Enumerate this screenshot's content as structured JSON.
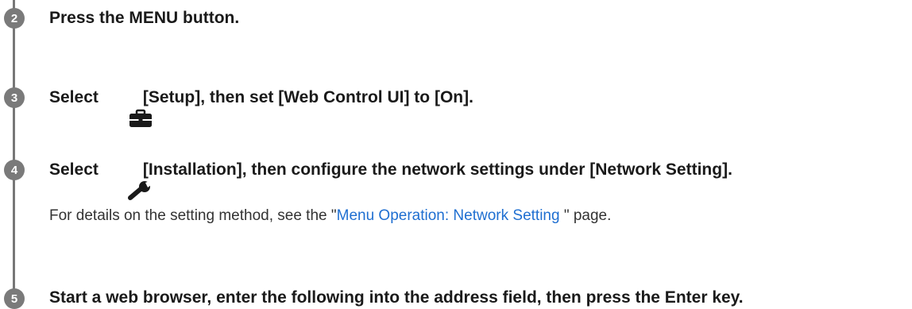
{
  "accent_color": "#1f6fd1",
  "badge_color": "#7a7a7a",
  "steps": [
    {
      "number": "2",
      "text": "Press the MENU button."
    },
    {
      "number": "3",
      "prefix": "Select",
      "icon": "toolbox-icon",
      "suffix": "[Setup], then set [Web Control UI] to [On]."
    },
    {
      "number": "4",
      "prefix": "Select",
      "icon": "wrench-icon",
      "suffix": "[Installation], then configure the network settings under [Network Setting]."
    },
    {
      "number": "5",
      "text": "Start a web browser, enter the following into the address field, then press the Enter key."
    }
  ],
  "detail": {
    "before": "For details on the setting method, see the \"",
    "link_text": "Menu Operation: Network Setting ",
    "after": "\" page."
  }
}
